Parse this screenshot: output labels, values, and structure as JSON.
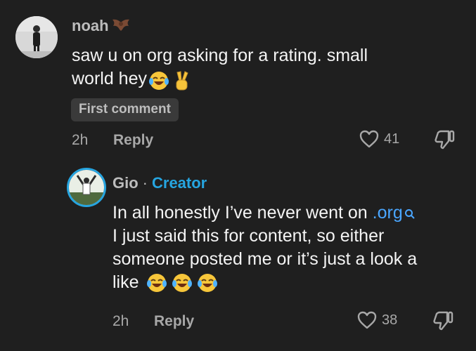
{
  "comment1": {
    "username": "noah",
    "username_emoji": "bat-icon",
    "text_line1": "saw u on org asking for a rating. small",
    "text_line2": "world hey",
    "emojis": [
      "laughing-tears-emoji",
      "victory-hand-emoji"
    ],
    "badge": "First comment",
    "time": "2h",
    "reply_label": "Reply",
    "likes": "41"
  },
  "comment2": {
    "username": "Gio",
    "separator": "·",
    "role": "Creator",
    "text_line1_prefix": "In all honestly I’ve never went on ",
    "text_link": ".org",
    "text_line2": "I just said this for content, so either",
    "text_line3": "someone posted me or it’s just a look a",
    "text_line4": "like",
    "emojis": [
      "laughing-tears-emoji",
      "laughing-tears-emoji",
      "laughing-tears-emoji"
    ],
    "time": "2h",
    "reply_label": "Reply",
    "likes": "38"
  },
  "colors": {
    "background": "#1f1f1f",
    "link": "#4aa6ff",
    "creator": "#26a5e0",
    "muted": "#a8a8a8"
  }
}
